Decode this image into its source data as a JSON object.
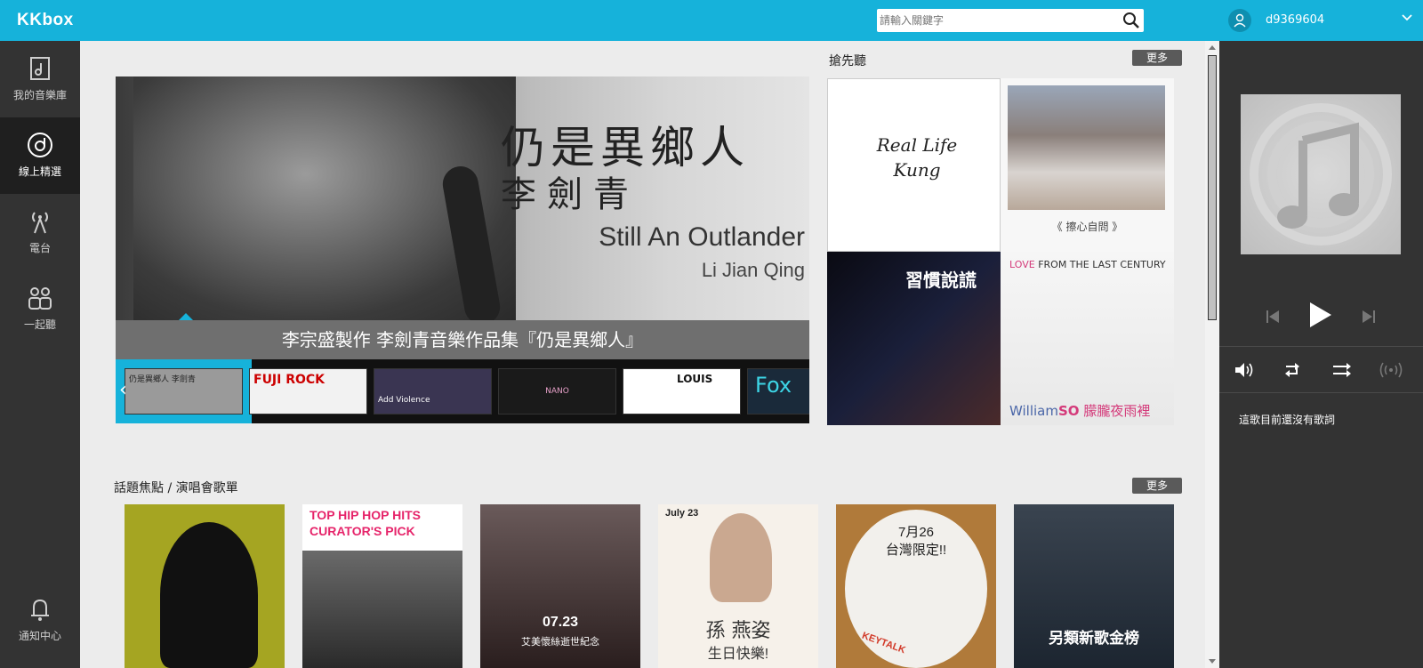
{
  "app": {
    "logo": "KKbox"
  },
  "search": {
    "placeholder": "請輸入關鍵字"
  },
  "sidebar": {
    "items": [
      {
        "label": "我的音樂庫",
        "icon": "library-icon",
        "active": false
      },
      {
        "label": "線上精選",
        "icon": "featured-icon",
        "active": true
      },
      {
        "label": "電台",
        "icon": "radio-icon",
        "active": false
      },
      {
        "label": "一起聽",
        "icon": "listen-together-icon",
        "active": false
      }
    ],
    "notification": {
      "label": "通知中心",
      "icon": "bell-icon"
    }
  },
  "hero": {
    "title_zh": "仍是異鄉人",
    "artist_zh": "李劍青",
    "title_en": "Still An Outlander",
    "artist_en": "Li Jian Qing",
    "caption": "李宗盛製作 李劍青音樂作品集『仍是異鄉人』"
  },
  "carousel": {
    "thumbs": [
      {
        "text": "仍是異鄉人 李劍青",
        "color": "#555555"
      },
      {
        "text": "FUJI ROCK",
        "color": "#ffffff"
      },
      {
        "text": "Add Violence",
        "color": "#3a3552"
      },
      {
        "text": "NANO",
        "color": "#1a1a1a"
      },
      {
        "text": "LOUIS",
        "color": "#ffffff"
      },
      {
        "text": "Fox",
        "color": "#1a2a3a"
      }
    ]
  },
  "early_listen": {
    "title": "搶先聽",
    "more": "更多",
    "albums": [
      {
        "text": "Real Life Kung"
      },
      {
        "text": "《 擦心自問 》"
      },
      {
        "text": "習慣說謊"
      },
      {
        "text_love": "LOVE",
        "text_rest": "FROM THE LAST CENTURY",
        "text_b1": "William",
        "text_b2": "SO",
        "text_b3": "朦朧夜雨裡"
      }
    ]
  },
  "topics": {
    "title": "話題焦點 / 演唱會歌單",
    "more": "更多",
    "cards": [
      {
        "text": ""
      },
      {
        "line1": "TOP HIP HOP HITS",
        "line2": "CURATOR'S PICK"
      },
      {
        "date": "07.23",
        "text": "艾美懷絲逝世紀念"
      },
      {
        "date": "July 23",
        "name": "孫 燕姿",
        "sub": "生日快樂!"
      },
      {
        "line1": "7月26",
        "line2": "台灣限定!!",
        "badge": "KEYTALK"
      },
      {
        "text": "另類新歌金榜"
      }
    ]
  },
  "player": {
    "username": "d9369604",
    "lyrics_msg": "這歌目前還沒有歌詞"
  },
  "colors": {
    "accent": "#16b2da",
    "sidebar": "#333333",
    "more_button": "#5a5a5a"
  }
}
